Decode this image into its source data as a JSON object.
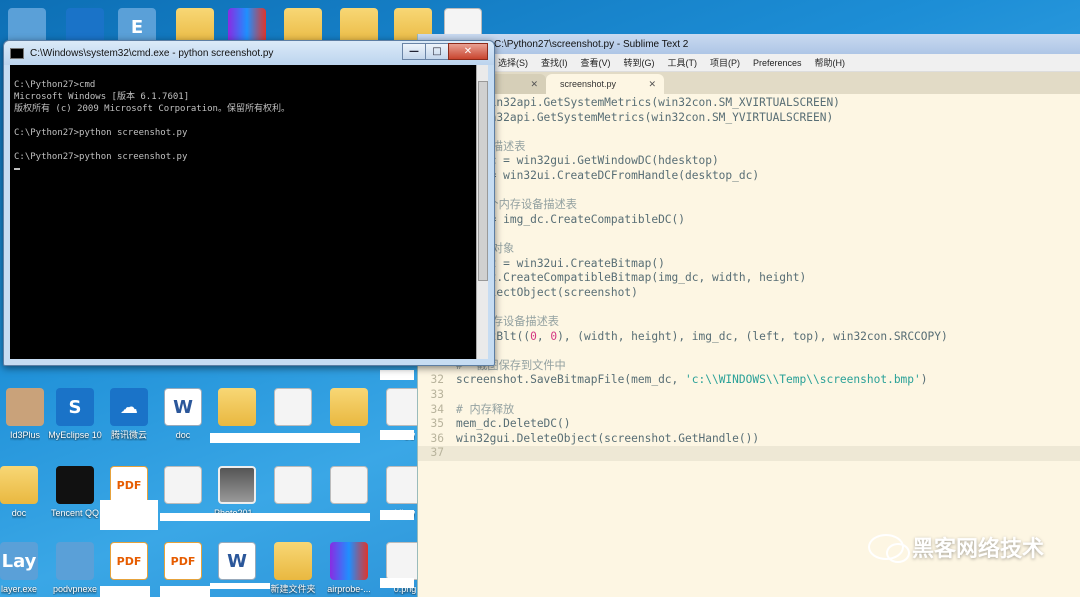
{
  "cmd_window": {
    "title": "C:\\Windows\\system32\\cmd.exe - python  screenshot.py",
    "lines": [
      "C:\\Python27>cmd",
      "Microsoft Windows [版本 6.1.7601]",
      "版权所有 (c) 2009 Microsoft Corporation。保留所有权利。",
      "",
      "C:\\Python27>python screenshot.py",
      "",
      "C:\\Python27>python screenshot.py",
      ""
    ],
    "buttons": {
      "minimize": "—",
      "maximize": "□",
      "close": "✕"
    }
  },
  "sublime": {
    "title": "C:\\Python27\\screenshot.py - Sublime Text 2",
    "menu": [
      "选择(S)",
      "查找(I)",
      "查看(V)",
      "转到(G)",
      "工具(T)",
      "项目(P)",
      "Preferences",
      "帮助(H)"
    ],
    "tabs": [
      {
        "label": "",
        "close": "✕",
        "active": false
      },
      {
        "label": "screenshot.py",
        "close": "✕",
        "active": true
      }
    ],
    "code_lines": [
      {
        "n": "",
        "text": "    win32api.GetSystemMetrics(win32con.SM_XVIRTUALSCREEN)"
      },
      {
        "n": "",
        "text": "   win32api.GetSystemMetrics(win32con.SM_YVIRTUALSCREEN)"
      },
      {
        "n": "",
        "text": ""
      },
      {
        "n": "",
        "text": "  设备描述表",
        "cls": "cmt"
      },
      {
        "n": "",
        "text": "  p_dc = win32gui.GetWindowDC(hdesktop)"
      },
      {
        "n": "",
        "text": "     = win32ui.CreateDCFromHandle(desktop_dc)"
      },
      {
        "n": "",
        "text": ""
      },
      {
        "n": "",
        "text": "   一个内存设备描述表",
        "cls": "cmt"
      },
      {
        "n": "",
        "text": "     = img_dc.CreateCompatibleDC()"
      },
      {
        "n": "",
        "text": ""
      },
      {
        "n": "",
        "text": "  位图对象",
        "cls": "cmt"
      },
      {
        "n": "",
        "text": "  shot = win32ui.CreateBitmap()"
      },
      {
        "n": "",
        "text": "  shot.CreateCompatibleBitmap(img_dc, width, height)"
      },
      {
        "n": "",
        "text": "  .SelectObject(screenshot)"
      },
      {
        "n": "",
        "text": ""
      },
      {
        "n": "",
        "text": "  至内存设备描述表",
        "cls": "cmt"
      },
      {
        "n": "",
        "text": "  .BitBlt((0, 0), (width, height), img_dc, (left, top), win32con.SRCCOPY)"
      },
      {
        "n": "",
        "text": ""
      },
      {
        "n": "",
        "text": "#  截图保存到文件中",
        "cls": "cmt"
      },
      {
        "n": "32",
        "text": "screenshot.SaveBitmapFile(mem_dc, 'c:\\\\WINDOWS\\\\Temp\\\\screenshot.bmp')"
      },
      {
        "n": "33",
        "text": ""
      },
      {
        "n": "34",
        "text": "# 内存释放",
        "cls": "cmt"
      },
      {
        "n": "35",
        "text": "mem_dc.DeleteDC()"
      },
      {
        "n": "36",
        "text": "win32gui.DeleteObject(screenshot.GetHandle())"
      },
      {
        "n": "37",
        "text": "",
        "cls": "cur"
      }
    ]
  },
  "desktop_icons": [
    {
      "label": "",
      "glyph": "",
      "style": "g-round"
    },
    {
      "label": "",
      "glyph": "",
      "style": "g-blue"
    },
    {
      "label": "",
      "glyph": "E",
      "style": "g-round"
    },
    {
      "label": "",
      "glyph": "",
      "style": "g-folder"
    },
    {
      "label": "",
      "glyph": "",
      "style": "g-rar"
    },
    {
      "label": "",
      "glyph": "",
      "style": "g-folder"
    },
    {
      "label": "",
      "glyph": "",
      "style": "g-folder"
    },
    {
      "label": "",
      "glyph": "",
      "style": "g-folder"
    },
    {
      "label": "",
      "glyph": "",
      "style": "g-file"
    },
    {
      "label": "Id3Plus",
      "glyph": "",
      "style": "g-person"
    },
    {
      "label": "MyEclipse 10",
      "glyph": "S",
      "style": "g-blue"
    },
    {
      "label": "腾讯微云",
      "glyph": "☁",
      "style": "g-blue"
    },
    {
      "label": "doc",
      "glyph": "W",
      "style": "g-word"
    },
    {
      "label": "",
      "glyph": "",
      "style": "g-folder"
    },
    {
      "label": "",
      "glyph": "",
      "style": "g-file"
    },
    {
      "label": "",
      "glyph": "",
      "style": "g-folder"
    },
    {
      "label": "kil.py",
      "glyph": "",
      "style": "g-file"
    },
    {
      "label": "doc",
      "glyph": "",
      "style": "g-folder"
    },
    {
      "label": "Tencent QQ",
      "glyph": "",
      "style": "g-qq"
    },
    {
      "label": "",
      "glyph": "PDF",
      "style": "g-pdf"
    },
    {
      "label": "",
      "glyph": "",
      "style": "g-file"
    },
    {
      "label": "Photo201...",
      "glyph": "",
      "style": "g-photo"
    },
    {
      "label": "",
      "glyph": "",
      "style": "g-file"
    },
    {
      "label": "",
      "glyph": "",
      "style": "g-file"
    },
    {
      "label": "kil.py",
      "glyph": "",
      "style": "g-file"
    },
    {
      "label": "layer.exe",
      "glyph": "Lay",
      "style": "g-round"
    },
    {
      "label": "podvpnexe",
      "glyph": "",
      "style": "g-round"
    },
    {
      "label": "",
      "glyph": "PDF",
      "style": "g-pdf"
    },
    {
      "label": "",
      "glyph": "PDF",
      "style": "g-pdf"
    },
    {
      "label": "",
      "glyph": "W",
      "style": "g-word"
    },
    {
      "label": "新建文件夹",
      "glyph": "",
      "style": "g-folder"
    },
    {
      "label": "airprobe-...",
      "glyph": "",
      "style": "g-rar"
    },
    {
      "label": "0.png",
      "glyph": "",
      "style": "g-file"
    }
  ],
  "watermark": {
    "text": "黑客网络技术"
  }
}
